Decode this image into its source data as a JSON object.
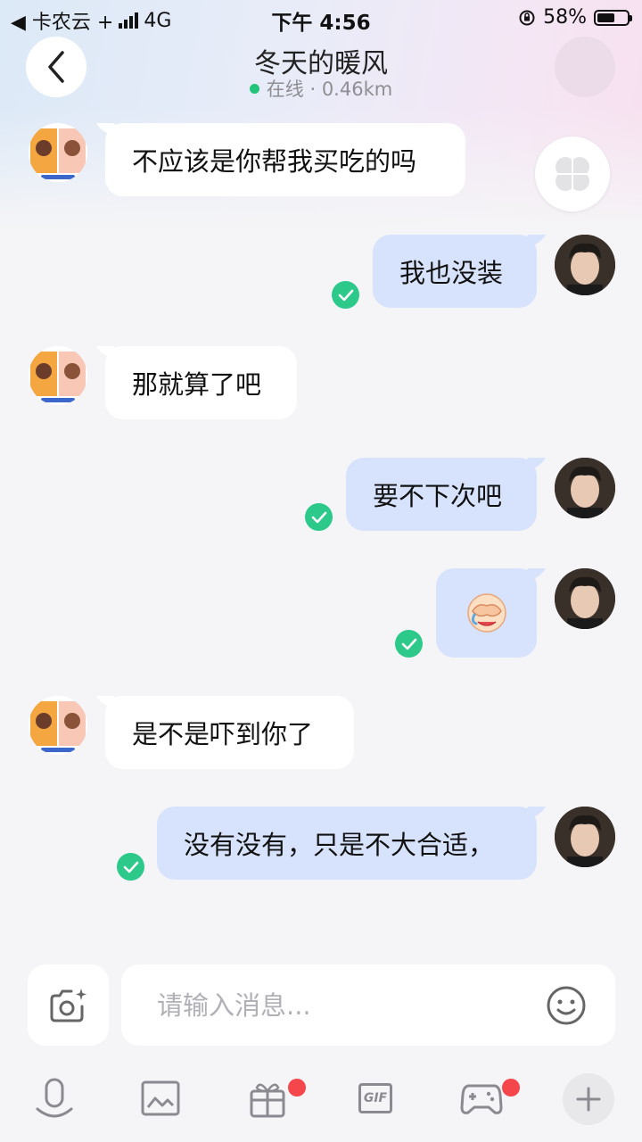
{
  "status_bar": {
    "carrier": "◀ 卡农云 +",
    "network": "4G",
    "time": "下午 4:56",
    "battery_pct": "58%",
    "battery_level": 0.58
  },
  "header": {
    "title": "冬天的暖风",
    "status": "在线",
    "distance": "· 0.46km"
  },
  "messages": [
    {
      "side": "in",
      "text": "不应该是你帮我买吃的吗"
    },
    {
      "side": "out",
      "text": "我也没装"
    },
    {
      "side": "in",
      "text": "那就算了吧"
    },
    {
      "side": "out",
      "text": "要不下次吧"
    },
    {
      "side": "out",
      "emoji": "face-covering-eyes-emoji"
    },
    {
      "side": "in",
      "text": "是不是吓到你了"
    },
    {
      "side": "out",
      "text": "没有没有，只是不大合适，"
    }
  ],
  "input": {
    "placeholder": "请输入消息..."
  },
  "toolbar": {
    "gif_label": "GIF",
    "items": [
      "voice-icon",
      "photo-icon",
      "gift-icon",
      "gif-icon",
      "game-icon",
      "plus-icon"
    ]
  },
  "colors": {
    "bubble_out": "#d7e3fd",
    "bubble_in": "#ffffff",
    "check_green": "#2dc98b",
    "online_dot": "#22c47a",
    "badge_red": "#f5474b"
  }
}
